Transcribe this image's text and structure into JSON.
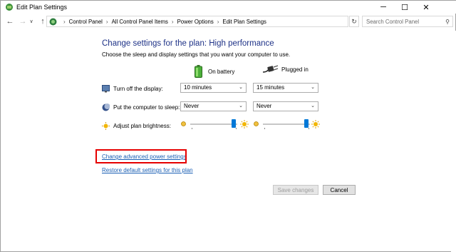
{
  "window": {
    "title": "Edit Plan Settings",
    "controls": {
      "minimize": "─",
      "maximize": "☐",
      "close": "✕"
    }
  },
  "nav": {
    "back": "←",
    "forward": "→",
    "recent": "∨",
    "up": "↑",
    "breadcrumbs": [
      "Control Panel",
      "All Control Panel Items",
      "Power Options",
      "Edit Plan Settings"
    ],
    "separator": "›",
    "breadcrumb_start_sep": "›",
    "dropdown": "∨",
    "refresh": "↻",
    "search_placeholder": "Search Control Panel",
    "search_icon": "⚲"
  },
  "main": {
    "heading": "Change settings for the plan: High performance",
    "subtitle": "Choose the sleep and display settings that you want your computer to use.",
    "columns": {
      "battery": "On battery",
      "plugged": "Plugged in"
    },
    "settings": [
      {
        "label": "Turn off the display:",
        "battery": "10 minutes",
        "plugged": "15 minutes"
      },
      {
        "label": "Put the computer to sleep:",
        "battery": "Never",
        "plugged": "Never"
      },
      {
        "label": "Adjust plan brightness:"
      }
    ],
    "brightness": {
      "battery_level": 0.93,
      "plugged_level": 0.93
    },
    "caret": "⌄",
    "links": {
      "advanced": "Change advanced power settings",
      "restore": "Restore default settings for this plan"
    },
    "buttons": {
      "save": "Save changes",
      "cancel": "Cancel"
    }
  },
  "colors": {
    "heading": "#1e3287",
    "link": "#1a5fb4",
    "highlight": "#e60000",
    "slider_thumb": "#0078d7"
  }
}
